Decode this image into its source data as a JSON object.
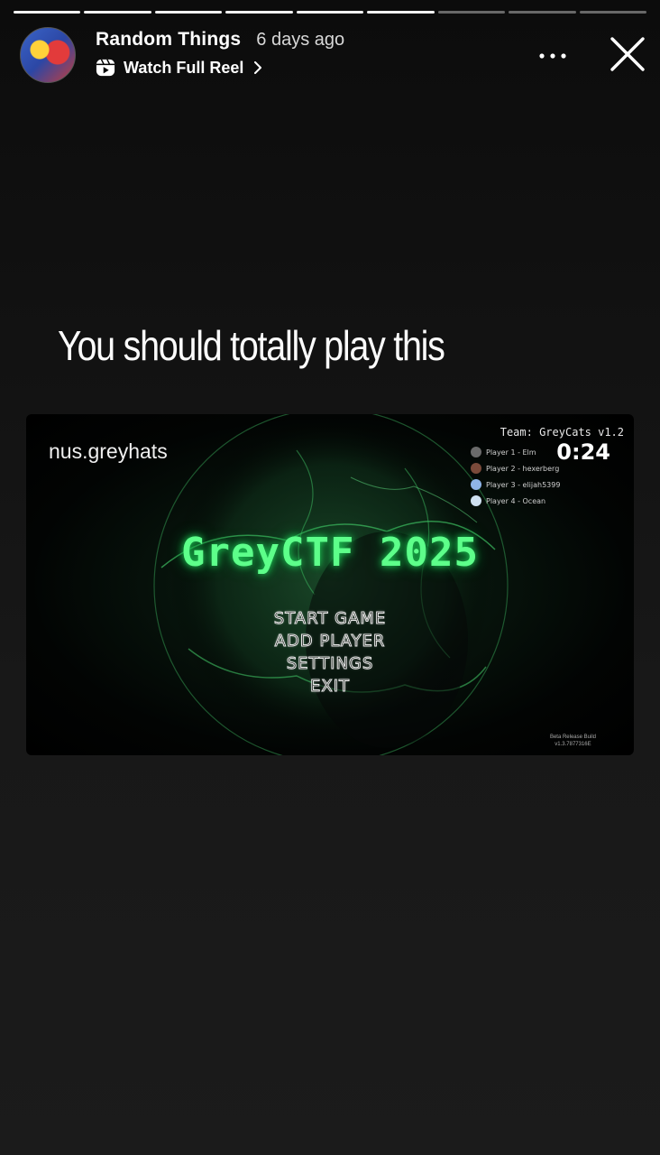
{
  "story": {
    "progress_segments": [
      1,
      1,
      1,
      1,
      1,
      1,
      0,
      0,
      0
    ],
    "active_progress": 0.0
  },
  "header": {
    "account_name": "Random Things",
    "time_ago": "6 days ago",
    "reel_link_label": "Watch Full Reel",
    "more_icon": "more-horizontal-icon",
    "close_icon": "close-icon"
  },
  "caption": "You should totally play this",
  "media": {
    "handle": "nus.greyhats",
    "team": "Team: GreyCats v1.2",
    "timer": "0:24",
    "players": [
      {
        "label": "Player 1 - Elm",
        "color": "#6a6a6a"
      },
      {
        "label": "Player 2 - hexerberg",
        "color": "#7a4a3a"
      },
      {
        "label": "Player 3 - elijah5399",
        "color": "#8fb4e8"
      },
      {
        "label": "Player 4 - Ocean",
        "color": "#cfe0f0"
      }
    ],
    "game_title": "GreyCTF 2025",
    "menu": [
      "START GAME",
      "ADD PLAYER",
      "SETTINGS",
      "EXIT"
    ],
    "build_line1": "Beta Release Build",
    "build_line2": "v1.3.7877316E"
  },
  "colors": {
    "accent_green": "#5dff8a",
    "background": "#121212"
  }
}
